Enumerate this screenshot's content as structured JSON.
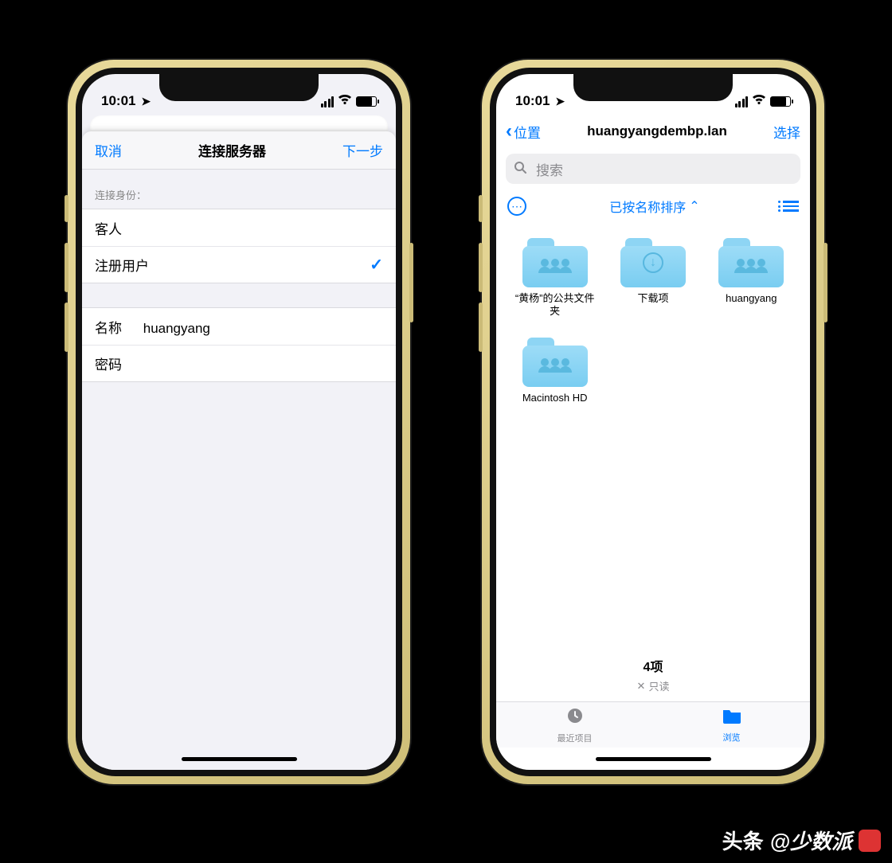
{
  "status": {
    "time": "10:01"
  },
  "left": {
    "nav": {
      "cancel": "取消",
      "title": "连接服务器",
      "next": "下一步"
    },
    "identity_header": "连接身份：",
    "identity": {
      "guest": "客人",
      "registered": "注册用户"
    },
    "fields": {
      "name_label": "名称",
      "name_value": "huangyang",
      "password_label": "密码",
      "password_value": ""
    }
  },
  "right": {
    "nav": {
      "back": "位置",
      "title": "huangyangdembp.lan",
      "select": "选择"
    },
    "search_placeholder": "搜索",
    "sort_label": "已按名称排序",
    "folders": [
      {
        "name": "“黄杨”的公共文件夹",
        "kind": "shared"
      },
      {
        "name": "下载项",
        "kind": "download"
      },
      {
        "name": "huangyang",
        "kind": "shared"
      },
      {
        "name": "Macintosh HD",
        "kind": "shared"
      }
    ],
    "summary": {
      "count": "4项",
      "readonly": "只读"
    },
    "tabs": {
      "recent": "最近项目",
      "browse": "浏览"
    }
  },
  "watermark": {
    "brand": "头条",
    "author": "@少数派"
  }
}
